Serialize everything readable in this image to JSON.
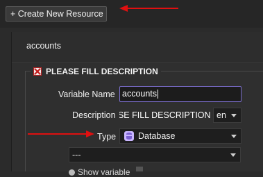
{
  "toolbar": {
    "create_button_label": "+ Create New Resource"
  },
  "resource": {
    "name": "accounts"
  },
  "form": {
    "legend": "PLEASE FILL DESCRIPTION",
    "variable_name_label": "Variable Name",
    "variable_name_value": "accounts",
    "description_label": "Description",
    "description_value": "PLEASE FILL DESCRIPTION",
    "language_value": "en",
    "type_label": "Type",
    "type_value": "Database",
    "sub_select_value": "---",
    "bottom_text": "Show variable"
  },
  "colors": {
    "annotation_arrow": "#e01010",
    "input_focus_border": "#7c6fcf",
    "error_icon": "#c21a1a"
  },
  "icons": [
    "close-error-icon",
    "database-icon",
    "chevron-down-icon",
    "radio-icon"
  ]
}
